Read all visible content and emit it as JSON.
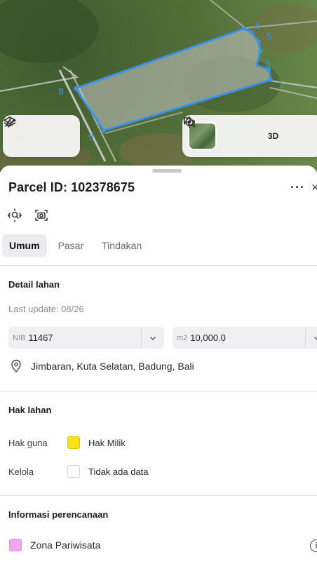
{
  "map": {
    "vertex_labels": [
      "1",
      "3",
      "5",
      "6",
      "8",
      "9"
    ],
    "parcel_stroke_color": "#3a93e8",
    "buttons": [
      "layers-icon",
      "measure-icon",
      "basemap-thumbnail",
      "locate-icon",
      "3d-toggle",
      "compare-icon"
    ],
    "btn_3d_label": "3D"
  },
  "sheet": {
    "title": "Parcel ID: 102378675",
    "more_label": "···",
    "close_label": "×",
    "tabs": [
      {
        "label": "Umum",
        "active": true
      },
      {
        "label": "Pasar",
        "active": false
      },
      {
        "label": "Tindakan",
        "active": false
      }
    ],
    "detail": {
      "heading": "Detail lahan",
      "last_update": "Last update: 08/26",
      "nib_prefix": "NIB",
      "nib_value": "11467",
      "area_prefix": "m2",
      "area_value": "10,000.0",
      "location": "Jimbaran, Kuta Selatan, Badung, Bali"
    },
    "rights": {
      "heading": "Hak lahan",
      "hak_guna_label": "Hak guna",
      "hak_guna_value": "Hak Milik",
      "hak_guna_color": "#f7e21b",
      "kelola_label": "Kelola",
      "kelola_value": "Tidak ada data",
      "kelola_color": "#ffffff"
    },
    "planning": {
      "heading": "Informasi perencanaan",
      "zone_label": "Zona Pariwisata",
      "zone_color": "#f3a6f0"
    }
  }
}
